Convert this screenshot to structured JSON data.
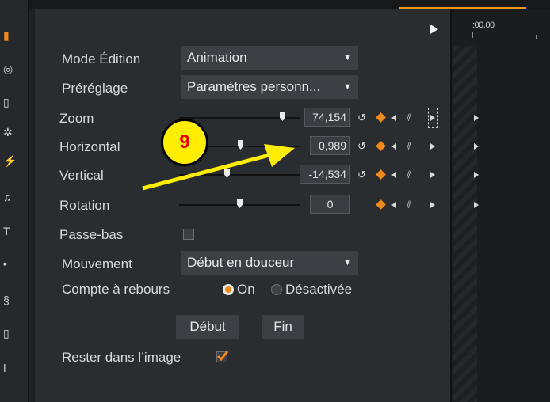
{
  "timeline": {
    "timecode": ":00.00"
  },
  "rows": {
    "mode": {
      "label": "Mode Édition",
      "value": "Animation"
    },
    "preset": {
      "label": "Préréglage",
      "value": "Paramètres personn..."
    },
    "zoom": {
      "label": "Zoom",
      "value": "74,154",
      "slider": 0.84
    },
    "horizontal": {
      "label": "Horizontal",
      "value": "0,989",
      "slider": 0.51
    },
    "vertical": {
      "label": "Vertical",
      "value": "-14,534",
      "slider": 0.36
    },
    "rotation": {
      "label": "Rotation",
      "value": "0",
      "slider": 0.5
    },
    "lowpass": {
      "label": "Passe-bas",
      "checked": false
    },
    "movement": {
      "label": "Mouvement",
      "value": "Début en douceur"
    },
    "countdown": {
      "label": "Compte à rebours",
      "on_label": "On",
      "off_label": "Désactivée",
      "selected": "On"
    },
    "stay": {
      "label": "Rester dans l’image",
      "checked": true
    }
  },
  "buttons": {
    "start": "Début",
    "end": "Fin"
  },
  "annotation": {
    "number": "9"
  },
  "colors": {
    "accent": "#f08a1c",
    "badge_fill": "#ffee00",
    "badge_text": "#e50000",
    "arrow": "#ffee00"
  },
  "icons": [
    "reset-icon",
    "keyframe-diamond-icon",
    "prev-keyframe-icon",
    "remove-keyframes-icon",
    "next-keyframe-icon",
    "play-icon",
    "dropdown-caret-icon"
  ]
}
